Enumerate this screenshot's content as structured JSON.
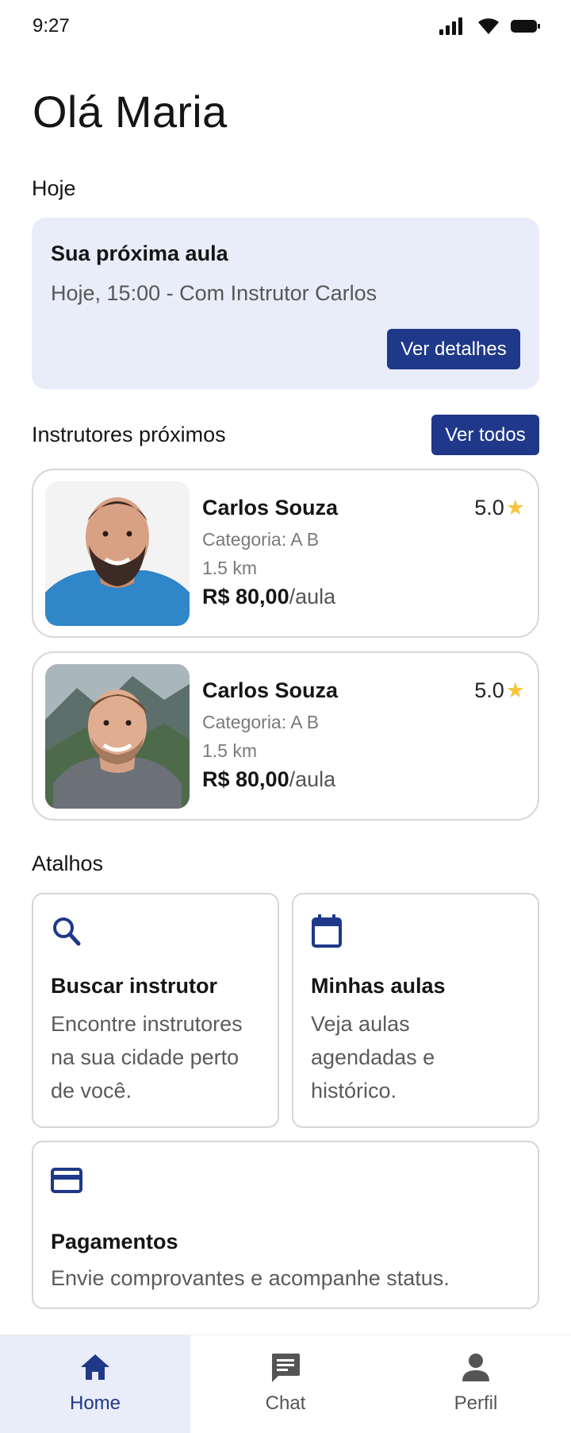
{
  "status_bar": {
    "time": "9:27"
  },
  "greeting": "Olá Maria",
  "today": {
    "section_title": "Hoje",
    "card_title": "Sua próxima aula",
    "card_subtitle": "Hoje, 15:00 - Com Instrutor Carlos",
    "details_button": "Ver detalhes"
  },
  "nearby": {
    "section_title": "Instrutores próximos",
    "see_all_button": "Ver todos",
    "instructors": [
      {
        "name": "Carlos Souza",
        "rating": "5.0",
        "category": "Categoria: A  B",
        "distance": "1.5 km",
        "price": "R$ 80,00",
        "price_unit": "/aula"
      },
      {
        "name": "Carlos Souza",
        "rating": "5.0",
        "category": "Categoria: A  B",
        "distance": "1.5 km",
        "price": "R$ 80,00",
        "price_unit": "/aula"
      }
    ]
  },
  "shortcuts": {
    "section_title": "Atalhos",
    "items": [
      {
        "title": "Buscar instrutor",
        "description": "Encontre instrutores na sua cidade perto de você.",
        "icon": "search-icon"
      },
      {
        "title": "Minhas aulas",
        "description": "Veja aulas agendadas e histórico.",
        "icon": "calendar-icon"
      },
      {
        "title": "Pagamentos",
        "description": "Envie comprovantes e acompanhe status.",
        "icon": "credit-card-icon"
      }
    ]
  },
  "bottom_nav": {
    "items": [
      {
        "label": "Home",
        "icon": "home-icon",
        "active": true
      },
      {
        "label": "Chat",
        "icon": "chat-icon",
        "active": false
      },
      {
        "label": "Perfil",
        "icon": "person-icon",
        "active": false
      }
    ]
  },
  "colors": {
    "primary": "#1f3889",
    "card_bg": "#e9ecf9",
    "star": "#f5c542"
  }
}
